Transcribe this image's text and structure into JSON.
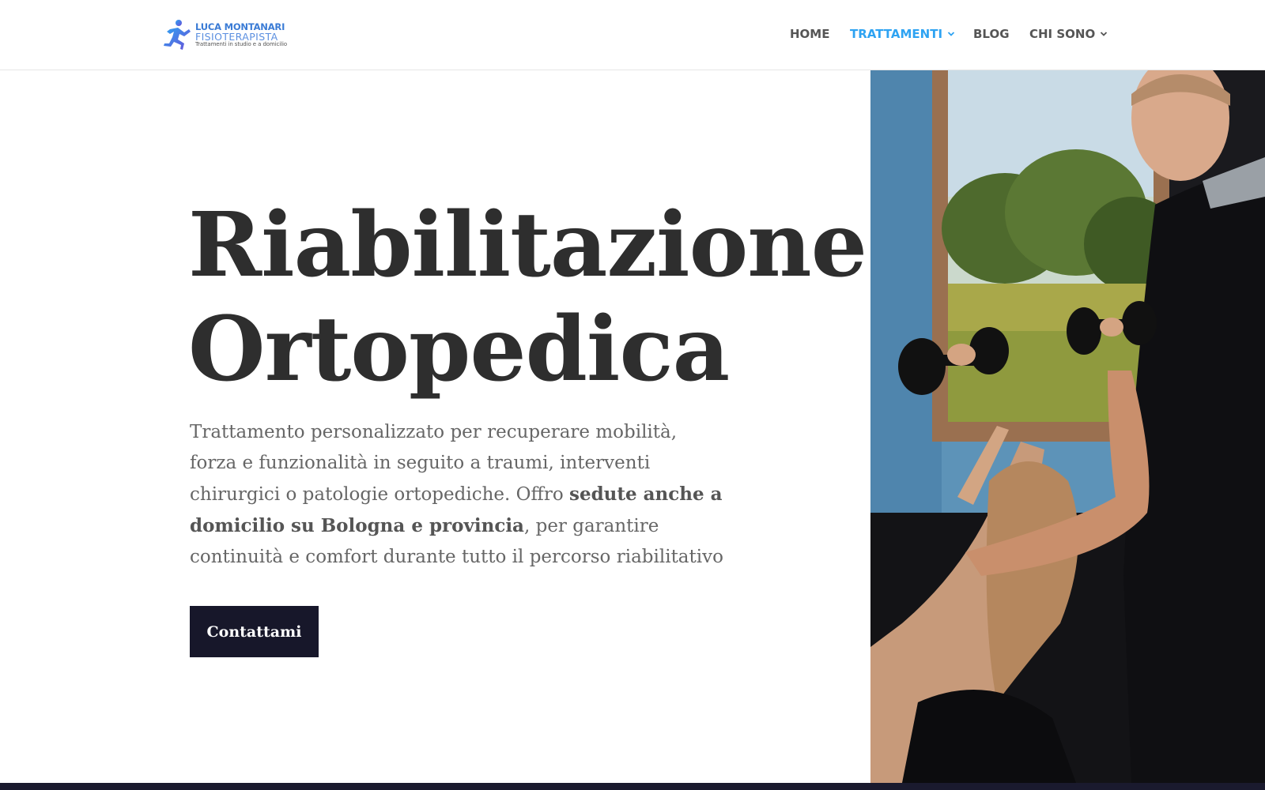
{
  "header": {
    "logo": {
      "name": "LUCA MONTANARI",
      "role": "FISIOTERAPISTA",
      "tagline": "Trattamenti in studio e a domicilio",
      "icon": "runner-logo-icon"
    },
    "nav": [
      {
        "label": "HOME",
        "active": false,
        "has_dropdown": false
      },
      {
        "label": "TRATTAMENTI",
        "active": true,
        "has_dropdown": true
      },
      {
        "label": "BLOG",
        "active": false,
        "has_dropdown": false
      },
      {
        "label": "CHI SONO",
        "active": false,
        "has_dropdown": true
      }
    ]
  },
  "hero": {
    "title_line1": "Riabilitazione",
    "title_line2": "Ortopedica",
    "desc_part1": "Trattamento personalizzato per recuperare mobilità, forza e funzionalità in seguito a traumi, interventi chirurgici o patologie ortopediche. Offro ",
    "desc_bold": "sedute anche a domicilio su Bologna e provincia",
    "desc_part2": ", per garantire continuità e comfort durante tutto il percorso riabilitativo",
    "cta_label": "Contattami"
  },
  "colors": {
    "accent": "#2ea3f2",
    "nav_text": "#555555",
    "title": "#2e2e2e",
    "cta_bg": "#17172a",
    "footer": "#1a1a2e"
  }
}
